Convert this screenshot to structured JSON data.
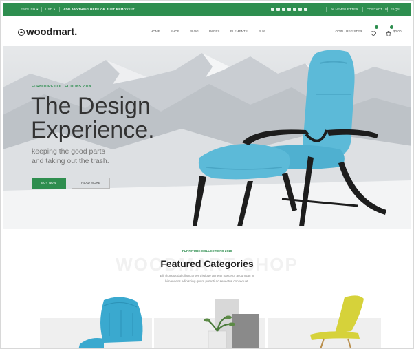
{
  "topbar": {
    "language": "ENGLISH",
    "currency": "USD",
    "promo": "ADD ANYTHING HERE OR JUST REMOVE IT...",
    "social_icons": [
      "facebook-icon",
      "twitter-icon",
      "google-plus-icon",
      "email-icon",
      "instagram-icon",
      "youtube-icon",
      "pinterest-icon"
    ],
    "newsletter": "NEWSLETTER",
    "contact": "CONTACT US",
    "faq": "FAQS"
  },
  "header": {
    "logo": "woodmart.",
    "nav": [
      "HOME",
      "SHOP",
      "BLOG",
      "PAGES",
      "ELEMENTS",
      "BUY"
    ],
    "login": "LOGIN / REGISTER",
    "cart_total": "$0.00"
  },
  "hero": {
    "kicker": "FURNITURE COLLECTIONS 2018",
    "title_line1": "The Design",
    "title_line2": "Experience.",
    "subtitle_line1": "keeping the good parts",
    "subtitle_line2": "and taking out the trash.",
    "buy_button": "BUY NOW",
    "read_button": "READ MORE"
  },
  "featured": {
    "kicker": "FURNITURE COLLECTIONS 2018",
    "watermark": "WOODMART SHOP",
    "title": "Featured Categories",
    "desc_line1": "Elit rhoncus dui ullamcorper tristique aenean nascetur accumsan in",
    "desc_line2": "himenaeos adipiscing quam potenti ac senectus consequat."
  },
  "colors": {
    "brand_green": "#2e8e4f",
    "chair_blue": "#5cbad8",
    "chair_yellow": "#d6d23a"
  }
}
